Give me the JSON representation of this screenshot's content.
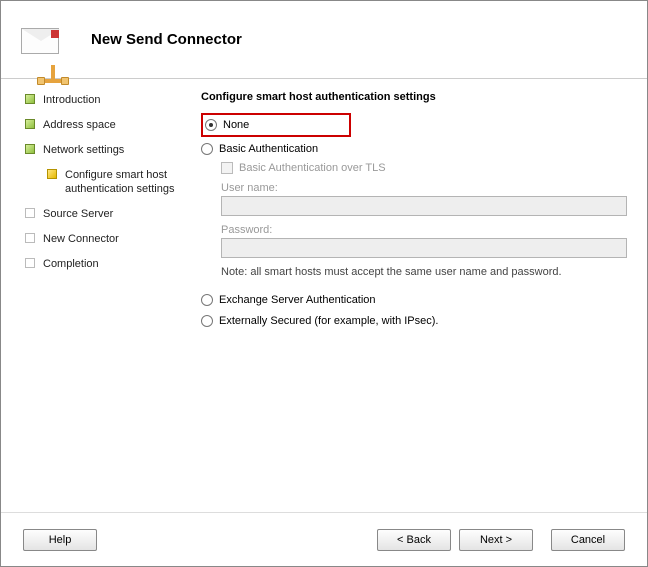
{
  "header": {
    "title": "New Send Connector"
  },
  "sidebar": {
    "items": [
      {
        "label": "Introduction",
        "state": "done"
      },
      {
        "label": "Address space",
        "state": "done"
      },
      {
        "label": "Network settings",
        "state": "done"
      },
      {
        "label": "Configure smart host authentication settings",
        "state": "current"
      },
      {
        "label": "Source Server",
        "state": "pending"
      },
      {
        "label": "New Connector",
        "state": "pending"
      },
      {
        "label": "Completion",
        "state": "pending"
      }
    ]
  },
  "content": {
    "title": "Configure smart host authentication settings",
    "options": {
      "none": "None",
      "basic": "Basic Authentication",
      "basic_tls": "Basic Authentication over TLS",
      "exchange": "Exchange Server Authentication",
      "external": "Externally Secured (for example, with IPsec)."
    },
    "fields": {
      "username_label": "User name:",
      "username_value": "",
      "password_label": "Password:",
      "password_value": ""
    },
    "note": "Note: all smart hosts must accept the same user name and password.",
    "selected": "none"
  },
  "footer": {
    "help": "Help",
    "back": "< Back",
    "next": "Next >",
    "cancel": "Cancel"
  }
}
